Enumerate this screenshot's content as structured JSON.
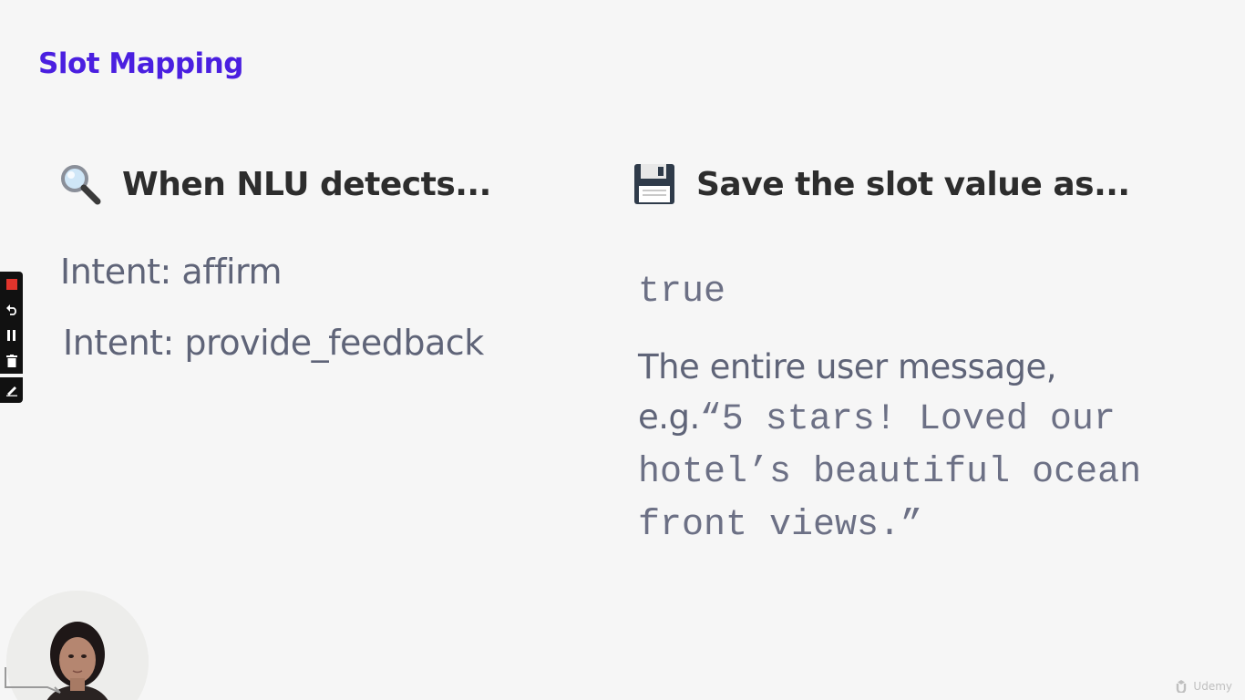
{
  "slide": {
    "title": "Slot Mapping"
  },
  "left": {
    "heading": "When NLU detects...",
    "icon": "magnifying-glass-icon",
    "intents": [
      "Intent: affirm",
      "Intent: provide_feedback"
    ]
  },
  "right": {
    "heading": "Save the slot value as...",
    "icon": "floppy-disk-icon",
    "value_true": "true",
    "message_intro": "The entire user message, e.g.",
    "message_quote": "“5 stars! Loved our hotel’s beautiful ocean front views.”"
  },
  "toolbar": {
    "icons": [
      "record-stop-icon",
      "undo-icon",
      "pause-icon",
      "trash-icon",
      "pen-icon"
    ]
  },
  "watermark": {
    "text": "Udemy"
  },
  "colors": {
    "title": "#4a1fe0",
    "heading": "#2d2d2d",
    "body": "#5f6478",
    "background": "#f6f6f6"
  }
}
